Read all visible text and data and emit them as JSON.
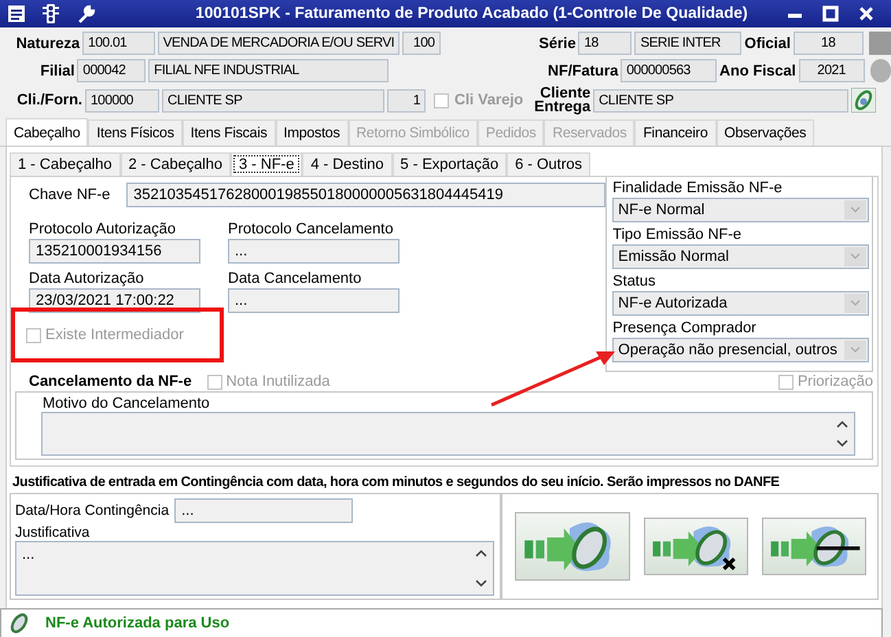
{
  "window": {
    "title": "100101SPK - Faturamento de Produto Acabado (1-Controle De Qualidade)"
  },
  "header": {
    "natureza": {
      "label": "Natureza",
      "code": "100.01",
      "description": "VENDA DE MERCADORIA E/OU SERVI",
      "number": "100"
    },
    "filial": {
      "label": "Filial",
      "code": "000042",
      "description": "FILIAL NFE INDUSTRIAL"
    },
    "cli_forn": {
      "label": "Cli./Forn.",
      "code": "100000",
      "description": "CLIENTE SP",
      "number": "1"
    },
    "cli_varejo": {
      "label": "Cli Varejo",
      "checked": false,
      "disabled": true
    },
    "serie": {
      "label": "Série",
      "code": "18",
      "description": "SERIE INTER"
    },
    "oficial": {
      "label": "Oficial",
      "value": "18"
    },
    "nf_fatura": {
      "label": "NF/Fatura",
      "value": "000000563"
    },
    "ano_fiscal": {
      "label": "Ano Fiscal",
      "value": "2021"
    },
    "cliente_entrega": {
      "label_lines": [
        "Cliente",
        "Entrega"
      ],
      "value": "CLIENTE SP"
    }
  },
  "tabs": [
    {
      "label": "Cabeçalho",
      "selected": true,
      "disabled": false
    },
    {
      "label": "Itens Físicos",
      "selected": false,
      "disabled": false
    },
    {
      "label": "Itens Fiscais",
      "selected": false,
      "disabled": false
    },
    {
      "label": "Impostos",
      "selected": false,
      "disabled": false
    },
    {
      "label": "Retorno Simbólico",
      "selected": false,
      "disabled": true
    },
    {
      "label": "Pedidos",
      "selected": false,
      "disabled": true
    },
    {
      "label": "Reservados",
      "selected": false,
      "disabled": true
    },
    {
      "label": "Financeiro",
      "selected": false,
      "disabled": false
    },
    {
      "label": "Observações",
      "selected": false,
      "disabled": false
    }
  ],
  "subtabs": [
    {
      "label": "1 - Cabeçalho",
      "selected": false
    },
    {
      "label": "2 - Cabeçalho",
      "selected": false
    },
    {
      "label": "3 - NF-e",
      "selected": true
    },
    {
      "label": "4 - Destino",
      "selected": false
    },
    {
      "label": "5 - Exportação",
      "selected": false
    },
    {
      "label": "6 - Outros",
      "selected": false
    }
  ],
  "nfe": {
    "chave": {
      "label": "Chave NF-e",
      "value": "35210354517628000198550180000005631804445419"
    },
    "protocolo_autorizacao": {
      "label": "Protocolo Autorização",
      "value": "135210001934156"
    },
    "protocolo_cancelamento": {
      "label": "Protocolo Cancelamento",
      "value": "..."
    },
    "data_autorizacao": {
      "label": "Data Autorização",
      "value": "23/03/2021 17:00:22"
    },
    "data_cancelamento": {
      "label": "Data Cancelamento",
      "value": "..."
    },
    "existe_intermediador": {
      "label": "Existe Intermediador",
      "checked": false,
      "disabled": true
    },
    "selects": [
      {
        "label": "Finalidade Emissão NF-e",
        "value": "NF-e Normal"
      },
      {
        "label": "Tipo Emissão NF-e",
        "value": "Emissão Normal"
      },
      {
        "label": "Status",
        "value": "NF-e Autorizada"
      },
      {
        "label": "Presença Comprador",
        "value": "Operação não presencial, outros"
      }
    ],
    "priorizacao": {
      "label": "Priorização",
      "checked": false,
      "disabled": true
    }
  },
  "cancelamento": {
    "title": "Cancelamento da NF-e",
    "nota_inutilizada": {
      "label": "Nota Inutilizada",
      "checked": false,
      "disabled": true
    },
    "motivo_label": "Motivo do Cancelamento"
  },
  "contingencia": {
    "title": "Justificativa de entrada em Contingência com data, hora com minutos e segundos do seu início. Serão impressos no DANFE",
    "data_hora": {
      "label": "Data/Hora Contingência",
      "value": "..."
    },
    "justificativa": {
      "label": "Justificativa",
      "value": "..."
    }
  },
  "actions": [
    {
      "kind": "transmit"
    },
    {
      "kind": "cancel"
    },
    {
      "kind": "disable"
    }
  ],
  "status_bar": {
    "message": "NF-e Autorizada para Uso"
  }
}
